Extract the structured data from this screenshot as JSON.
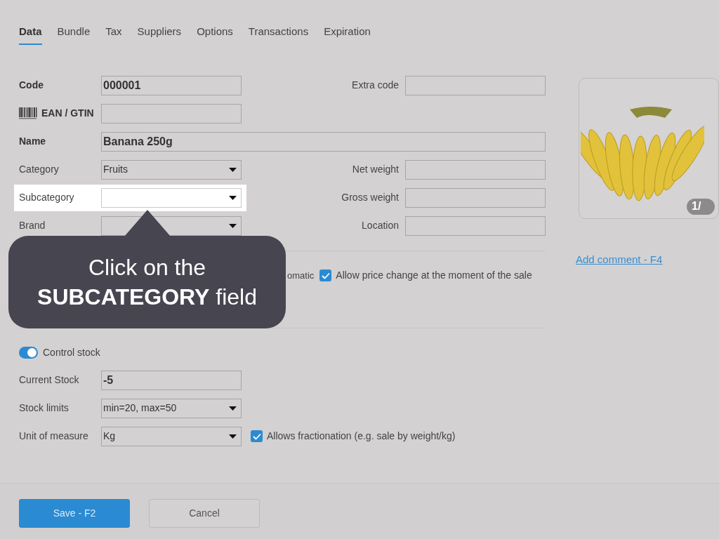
{
  "tabs": [
    {
      "label": "Data",
      "selected": true
    },
    {
      "label": "Bundle",
      "selected": false
    },
    {
      "label": "Tax",
      "selected": false
    },
    {
      "label": "Suppliers",
      "selected": false
    },
    {
      "label": "Options",
      "selected": false
    },
    {
      "label": "Transactions",
      "selected": false
    },
    {
      "label": "Expiration",
      "selected": false
    }
  ],
  "product_rows": [
    {
      "label": "Code",
      "bold": true,
      "label_icon": false,
      "kind": "text",
      "value": "000001",
      "full_width": false,
      "highlighted": false,
      "right": {
        "label": "Extra code"
      }
    },
    {
      "label": "EAN / GTIN",
      "bold": true,
      "label_icon": true,
      "kind": "text",
      "full_width": false,
      "highlighted": false
    },
    {
      "label": "Name",
      "bold": true,
      "label_icon": false,
      "kind": "text",
      "value": "Banana 250g",
      "full_width": true,
      "highlighted": false
    },
    {
      "label": "Category",
      "bold": false,
      "label_icon": false,
      "kind": "select",
      "value": "Fruits",
      "full_width": false,
      "highlighted": false,
      "right": {
        "label": "Net weight"
      }
    },
    {
      "label": "Subcategory",
      "bold": false,
      "label_icon": false,
      "kind": "select",
      "full_width": false,
      "highlighted": true,
      "right": {
        "label": "Gross weight"
      }
    },
    {
      "label": "Brand",
      "bold": false,
      "label_icon": false,
      "kind": "select",
      "full_width": false,
      "highlighted": false,
      "right": {
        "label": "Location"
      }
    }
  ],
  "price_options": {
    "partial_text": "omatic",
    "checkbox": {
      "label": "Allow price change at the moment of the sale",
      "checked": true
    }
  },
  "stock": {
    "toggle": {
      "label": "Control stock",
      "on": true
    },
    "rows": [
      {
        "label": "Current Stock",
        "kind": "text",
        "value": "-5"
      },
      {
        "label": "Stock limits",
        "kind": "select",
        "value": "min=20, max=50"
      },
      {
        "label": "Unit of measure",
        "kind": "select",
        "value": "Kg",
        "checkbox": {
          "label": "Allows fractionation (e.g. sale by weight/kg)",
          "checked": true
        }
      }
    ]
  },
  "image": {
    "counter": "1/"
  },
  "comment_link": "Add comment - F4",
  "tooltip": {
    "lines": [
      "Click on the",
      "**SUBCATEGORY** field"
    ]
  },
  "buttons": [
    {
      "label": "Save - F2",
      "kind": "primary"
    },
    {
      "label": "Cancel",
      "kind": "secondary"
    }
  ]
}
